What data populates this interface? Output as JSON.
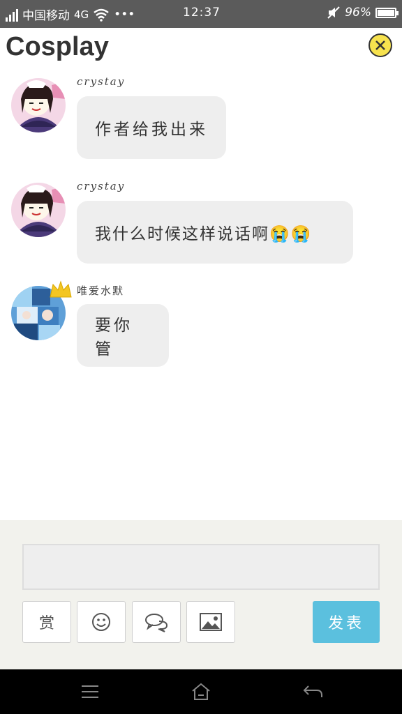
{
  "status_bar": {
    "carrier": "中国移动",
    "network": "4G",
    "dots": "•••",
    "time": "12:37",
    "battery": "96%"
  },
  "header": {
    "title": "Cosplay"
  },
  "messages": [
    {
      "user": "crystay",
      "text": "作者给我出来"
    },
    {
      "user": "crystay",
      "text": "我什么时候这样说话啊😭😭"
    },
    {
      "user": "唯爱水默",
      "text": "要你管"
    }
  ],
  "composer": {
    "reward_label": "赏",
    "send_label": "发表"
  },
  "colors": {
    "accent": "#5bc0de",
    "close_button": "#f7e24e",
    "bubble": "#eeeeee"
  },
  "icons": [
    "signal-icon",
    "wifi-icon",
    "mute-icon",
    "battery-icon",
    "close-icon",
    "smiley-icon",
    "chat-icon",
    "image-icon",
    "menu-icon",
    "home-icon",
    "back-icon",
    "crown-icon"
  ]
}
